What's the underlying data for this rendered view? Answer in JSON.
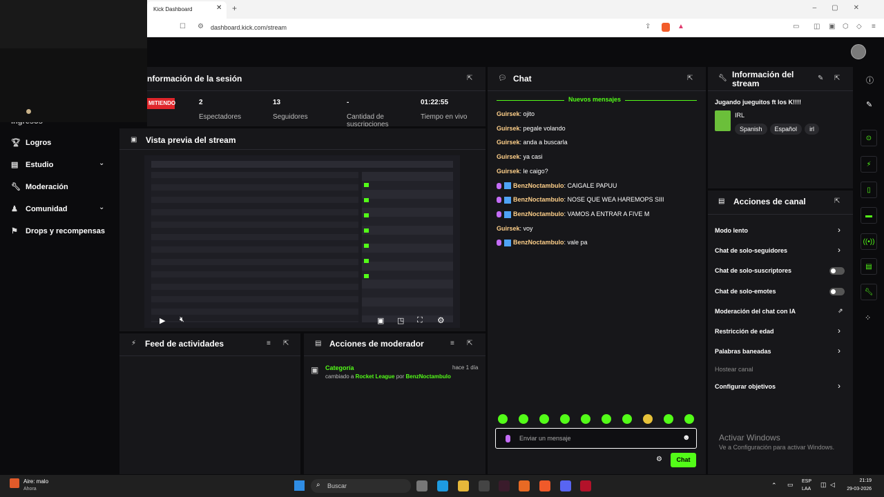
{
  "browser": {
    "tab_title": "Kick Dashboard",
    "url": "dashboard.kick.com/stream"
  },
  "sidebar": {
    "partial_top": "Ingresos",
    "items": [
      {
        "label": "Logros"
      },
      {
        "label": "Estudio"
      },
      {
        "label": "Moderación"
      },
      {
        "label": "Comunidad"
      },
      {
        "label": "Drops y recompensas"
      }
    ]
  },
  "session": {
    "title": "nformación de la sesión",
    "live_badge": "MITIENDO",
    "stats": [
      {
        "value": "2",
        "label": "Espectadores"
      },
      {
        "value": "13",
        "label": "Seguidores"
      },
      {
        "value": "-",
        "label": "Cantidad de suscripciones"
      },
      {
        "value": "01:22:55",
        "label": "Tiempo en vivo"
      }
    ]
  },
  "preview": {
    "title": "Vista previa del stream"
  },
  "feed": {
    "title": "Feed de actividades"
  },
  "mod_actions": {
    "title": "Acciones de moderador",
    "entry_title": "Categoría",
    "entry_time": "hace 1 día",
    "entry_prefix": "cambiado a",
    "entry_category": "Rocket League",
    "entry_by": "por",
    "entry_user": "BenzNoctambulo"
  },
  "chat": {
    "title": "Chat",
    "new_messages": "Nuevos mensajes",
    "messages": [
      {
        "user": "Guirsek",
        "text": "ojito",
        "badges": false
      },
      {
        "user": "Guirsek",
        "text": "pegale volando",
        "badges": false
      },
      {
        "user": "Guirsek",
        "text": "anda a buscarla",
        "badges": false
      },
      {
        "user": "Guirsek",
        "text": "ya casi",
        "badges": false
      },
      {
        "user": "Guirsek",
        "text": "le caigo?",
        "badges": false
      },
      {
        "user": "BenzNoctambulo",
        "text": "CAIGALE PAPUU",
        "badges": true
      },
      {
        "user": "BenzNoctambulo",
        "text": "NOSE QUE WEA HAREMOPS SIII",
        "badges": true
      },
      {
        "user": "BenzNoctambulo",
        "text": "VAMOS A ENTRAR A FIVE M",
        "badges": true
      },
      {
        "user": "Guirsek",
        "text": "voy",
        "badges": false
      },
      {
        "user": "BenzNoctambulo",
        "text": "vale pa",
        "badges": true
      }
    ],
    "input_placeholder": "Enviar un mensaje",
    "send_label": "Chat"
  },
  "stream_info": {
    "title_line1": "Información del",
    "title_line2": "stream",
    "stream_title": "Jugando jueguitos ft los K!!!!",
    "category": "IRL",
    "tags": [
      "Spanish",
      "Español",
      "irl"
    ]
  },
  "channel_actions": {
    "title": "Acciones de canal",
    "items": [
      {
        "label": "Modo lento",
        "control": "arrow"
      },
      {
        "label": "Chat de solo-seguidores",
        "control": "arrow"
      },
      {
        "label": "Chat de solo-suscriptores",
        "control": "toggle"
      },
      {
        "label": "Chat de solo-emotes",
        "control": "toggle"
      },
      {
        "label": "Moderación del chat con IA",
        "control": "external"
      },
      {
        "label": "Restricción de edad",
        "control": "arrow"
      },
      {
        "label": "Palabras baneadas",
        "control": "arrow"
      },
      {
        "label": "Hostear canal",
        "control": "disabled"
      },
      {
        "label": "Configurar objetivos",
        "control": "arrow"
      }
    ]
  },
  "watermark": {
    "line1": "Activar Windows",
    "line2": "Ve a Configuración para activar Windows."
  },
  "taskbar": {
    "weather_title": "Aire: malo",
    "weather_sub": "Ahora",
    "search": "Buscar",
    "lang1": "ESP",
    "lang2": "LAA",
    "time": "21:19",
    "date": "29-03-2026"
  },
  "colors": {
    "accent": "#53fc18",
    "live": "#e0262b",
    "username": "#ffd08a"
  }
}
